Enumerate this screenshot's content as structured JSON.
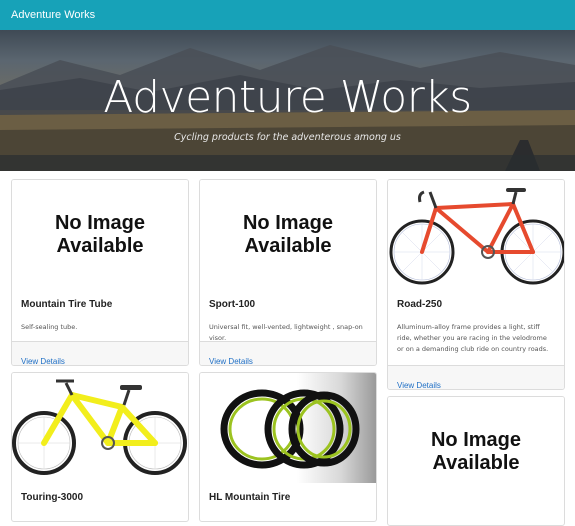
{
  "navbar": {
    "brand": "Adventure Works"
  },
  "hero": {
    "title": "Adventure Works",
    "tagline": "Cycling products for the adventerous among us"
  },
  "placeholder": {
    "line1": "No Image",
    "line2": "Available"
  },
  "products": [
    {
      "name": "Mountain Tire Tube",
      "description": "Self-sealing tube.",
      "link": "View Details",
      "image": "no-image"
    },
    {
      "name": "Sport-100",
      "description": "Universal fit, well-vented, lightweight , snap-on visor.",
      "link": "View Details",
      "image": "no-image"
    },
    {
      "name": "Road-250",
      "description": "Alluminum-alloy frame provides a light, stiff ride, whether you are racing in the velodrome or on a demanding club ride on country roads.",
      "link": "View Details",
      "image": "red-road-bike"
    },
    {
      "name": "Touring-3000",
      "description": "",
      "link": "",
      "image": "yellow-touring-bike"
    },
    {
      "name": "HL Mountain Tire",
      "description": "",
      "link": "",
      "image": "tires"
    },
    {
      "name": "",
      "description": "",
      "link": "",
      "image": "no-image"
    }
  ],
  "colors": {
    "navbar": "#17a2b8",
    "link": "#1f6fc5",
    "road_bike_frame": "#e64a2e",
    "touring_bike_frame": "#f2ee1c"
  }
}
